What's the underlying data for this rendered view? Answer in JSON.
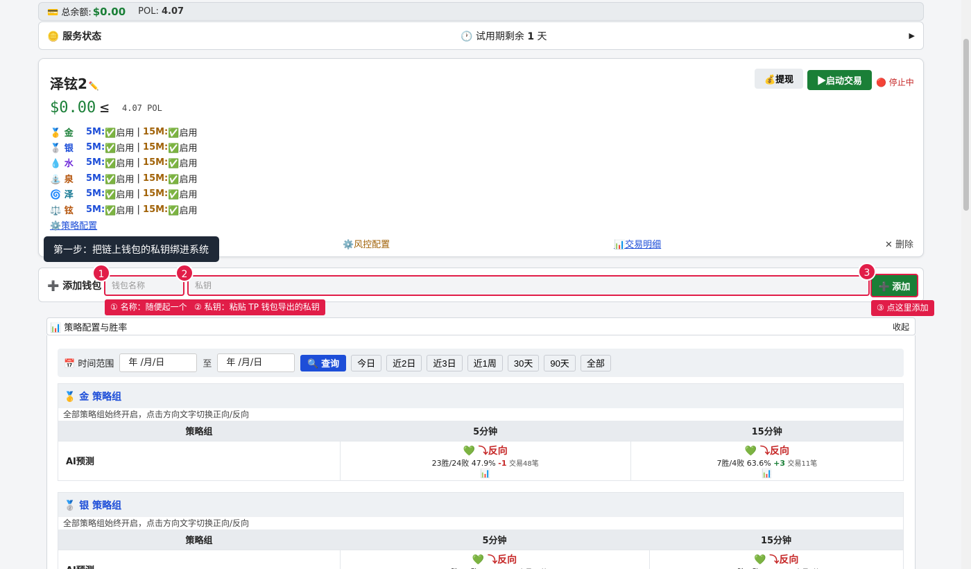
{
  "balance": {
    "label": "💳 总余额:",
    "amount": "$0.00",
    "pol_label": "POL:",
    "pol_value": "4.07"
  },
  "service": {
    "title": "🪙 服务状态",
    "trial_prefix": "🕐 试用期剩余",
    "trial_days": "1",
    "trial_suffix": "天",
    "expand_icon": "▶"
  },
  "wallet": {
    "name": "泽铉2",
    "edit_icon": "✏️",
    "usd": "$0.00",
    "le": "≤",
    "pol": "4.07 POL",
    "withdraw_label": "💰提现",
    "start_label": "▶启动交易",
    "status_label": "🔴 停止中",
    "strategies": [
      {
        "icon": "🥇",
        "name": "金",
        "color": "#1a7f37",
        "m5": "5M:",
        "m5_state": "✅启用",
        "sep": " | ",
        "m15": "15M:",
        "m15_state": "✅启用"
      },
      {
        "icon": "🥈",
        "name": "银",
        "color": "#1d4ed8",
        "m5": "5M:",
        "m5_state": "✅启用",
        "sep": " | ",
        "m15": "15M:",
        "m15_state": "✅启用"
      },
      {
        "icon": "💧",
        "name": "水",
        "color": "#6d28d9",
        "m5": "5M:",
        "m5_state": "✅启用",
        "sep": " | ",
        "m15": "15M:",
        "m15_state": "✅启用"
      },
      {
        "icon": "⛲",
        "name": "泉",
        "color": "#b45309",
        "m5": "5M:",
        "m5_state": "✅启用",
        "sep": " | ",
        "m15": "15M:",
        "m15_state": "✅启用"
      },
      {
        "icon": "🌀",
        "name": "泽",
        "color": "#0e7490",
        "m5": "5M:",
        "m5_state": "✅启用",
        "sep": " | ",
        "m15": "15M:",
        "m15_state": "✅启用"
      },
      {
        "icon": "⚖️",
        "name": "铉",
        "color": "#b45309",
        "m5": "5M:",
        "m5_state": "✅启用",
        "sep": " | ",
        "m15": "15M:",
        "m15_state": "✅启用"
      }
    ],
    "strategy_config": "⚙️策略配置",
    "risk_config": "⚙️风控配置",
    "trade_detail": "📊交易明细",
    "delete": "✕ 删除"
  },
  "tooltip": "第一步：把链上钱包的私钥绑进系统",
  "add_wallet": {
    "label": "➕ 添加钱包",
    "name_placeholder": "钱包名称",
    "key_placeholder": "私钥",
    "add_button": "➕ 添加",
    "badge1": "1",
    "badge2": "2",
    "badge3": "3",
    "hint1": "① 名称：随便起一个",
    "hint2": "② 私钥：粘贴 TP 钱包导出的私钥",
    "hint3": "③ 点这里添加"
  },
  "strategy_section": {
    "title": "📊 策略配置与胜率",
    "collapse": "收起",
    "range_label": "📅 时间范围",
    "date_placeholder": "年 /月/日",
    "to": "至",
    "query": "🔍 查询",
    "ranges": [
      "今日",
      "近2日",
      "近3日",
      "近1周",
      "30天",
      "90天",
      "全部"
    ],
    "groups": [
      {
        "title": "🥇 金 策略组",
        "note": "全部策略组始终开启，点击方向文字切换正向/反向",
        "headers": [
          "策略组",
          "5分钟",
          "15分钟"
        ],
        "row_label": "AI预测",
        "cells": [
          {
            "dir": "💚 ⤵反向",
            "stat": "23胜/24败 47.9%",
            "delta": "-1",
            "delta_sign": "neg",
            "count": "交易48笔",
            "chart": "📊"
          },
          {
            "dir": "💚 ⤵反向",
            "stat": "7胜/4败 63.6%",
            "delta": "+3",
            "delta_sign": "pos",
            "count": "交易11笔",
            "chart": "📊"
          }
        ]
      },
      {
        "title": "🥈 银 策略组",
        "note": "全部策略组始终开启，点击方向文字切换正向/反向",
        "headers": [
          "策略组",
          "5分钟",
          "15分钟"
        ],
        "row_label": "AI预测",
        "cells": [
          {
            "dir": "💚 ⤵反向",
            "stat": "17胜/25败 40.5%",
            "delta": "-8",
            "delta_sign": "neg",
            "count": "交易42笔",
            "chart": "📊"
          },
          {
            "dir": "💚 ⤵反向",
            "stat": "0胜/1败 0.0%",
            "delta": "-1",
            "delta_sign": "neg",
            "count": "交易1笔",
            "chart": "📊"
          }
        ]
      }
    ]
  }
}
